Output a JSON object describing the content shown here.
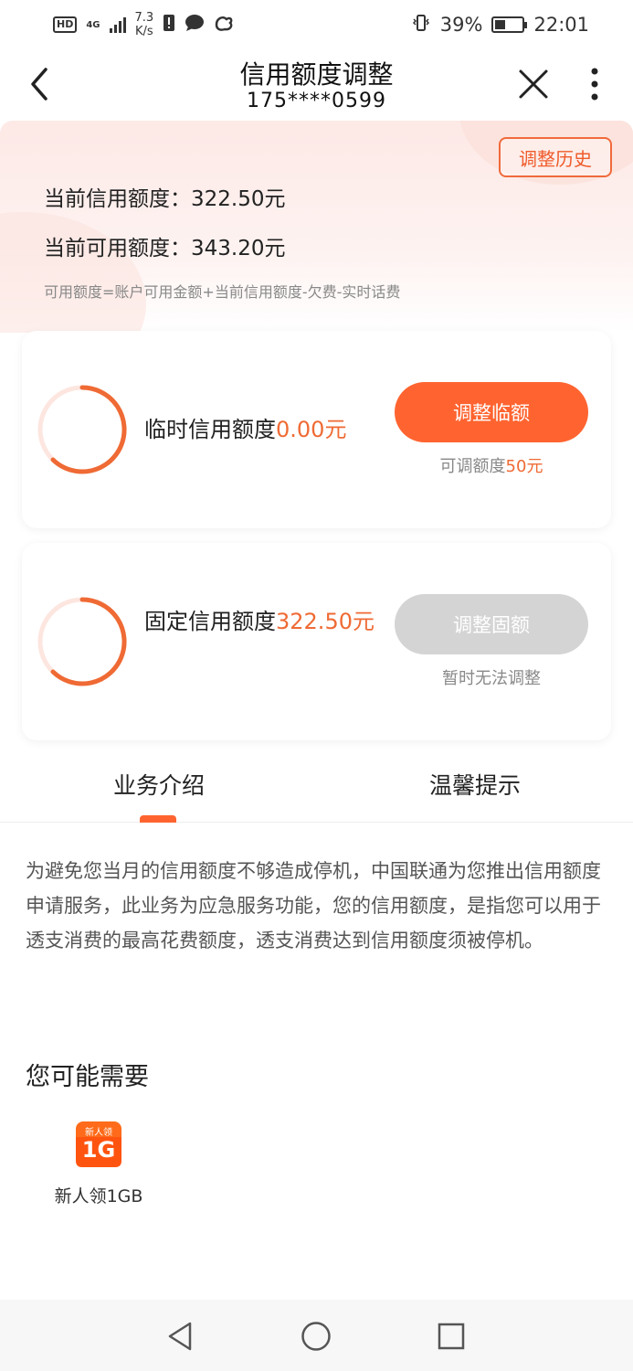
{
  "status_bar": {
    "hd": "HD",
    "network": "4G",
    "speed_value": "7.3",
    "speed_unit": "K/s",
    "battery_percent": "39%",
    "battery_level": 0.39,
    "time": "22:01",
    "icons": [
      "signal-icon",
      "alert-icon",
      "message-icon",
      "uc-browser-icon",
      "vibrate-icon",
      "battery-icon"
    ]
  },
  "navbar": {
    "title": "信用额度调整",
    "subtitle": "175****0599",
    "icons": [
      "back-arrow-icon",
      "close-icon",
      "more-vertical-icon"
    ]
  },
  "hero": {
    "history_button": "调整历史",
    "current_credit_label": "当前信用额度：",
    "current_credit_value": "322.50元",
    "available_credit_label": "当前可用额度：",
    "available_credit_value": "343.20元",
    "formula": "可用额度=账户可用金额+当前信用额度-欠费-实时话费"
  },
  "cards": [
    {
      "label": "临时信用额度",
      "amount": "0.00元",
      "button": "调整临额",
      "note_prefix": "可调额度",
      "note_highlight": "50元",
      "button_state": "active"
    },
    {
      "label": "固定信用额度",
      "amount": "322.50元",
      "button": "调整固额",
      "note": "暂时无法调整",
      "button_state": "disabled"
    }
  ],
  "tabs": [
    {
      "label": "业务介绍",
      "active": true
    },
    {
      "label": "温馨提示",
      "active": false
    }
  ],
  "intro_text": "为避免您当月的信用额度不够造成停机，中国联通为您推出信用额度申请服务，此业务为应急服务功能，您的信用额度，是指您可以用于透支消费的最高花费额度，透支消费达到信用额度须被停机。",
  "recommend": {
    "title": "您可能需要",
    "items": [
      {
        "icon_text_top": "新人领",
        "icon_text_main": "1G",
        "label": "新人领1GB"
      }
    ]
  },
  "system_nav": {
    "icons": [
      "nav-back-triangle-icon",
      "nav-home-circle-icon",
      "nav-recents-square-icon"
    ]
  },
  "colors": {
    "accent": "#ff6430",
    "accent_text": "#ef6a34",
    "disabled": "#d4d4d4",
    "hero_bg": "#fde9e6"
  }
}
